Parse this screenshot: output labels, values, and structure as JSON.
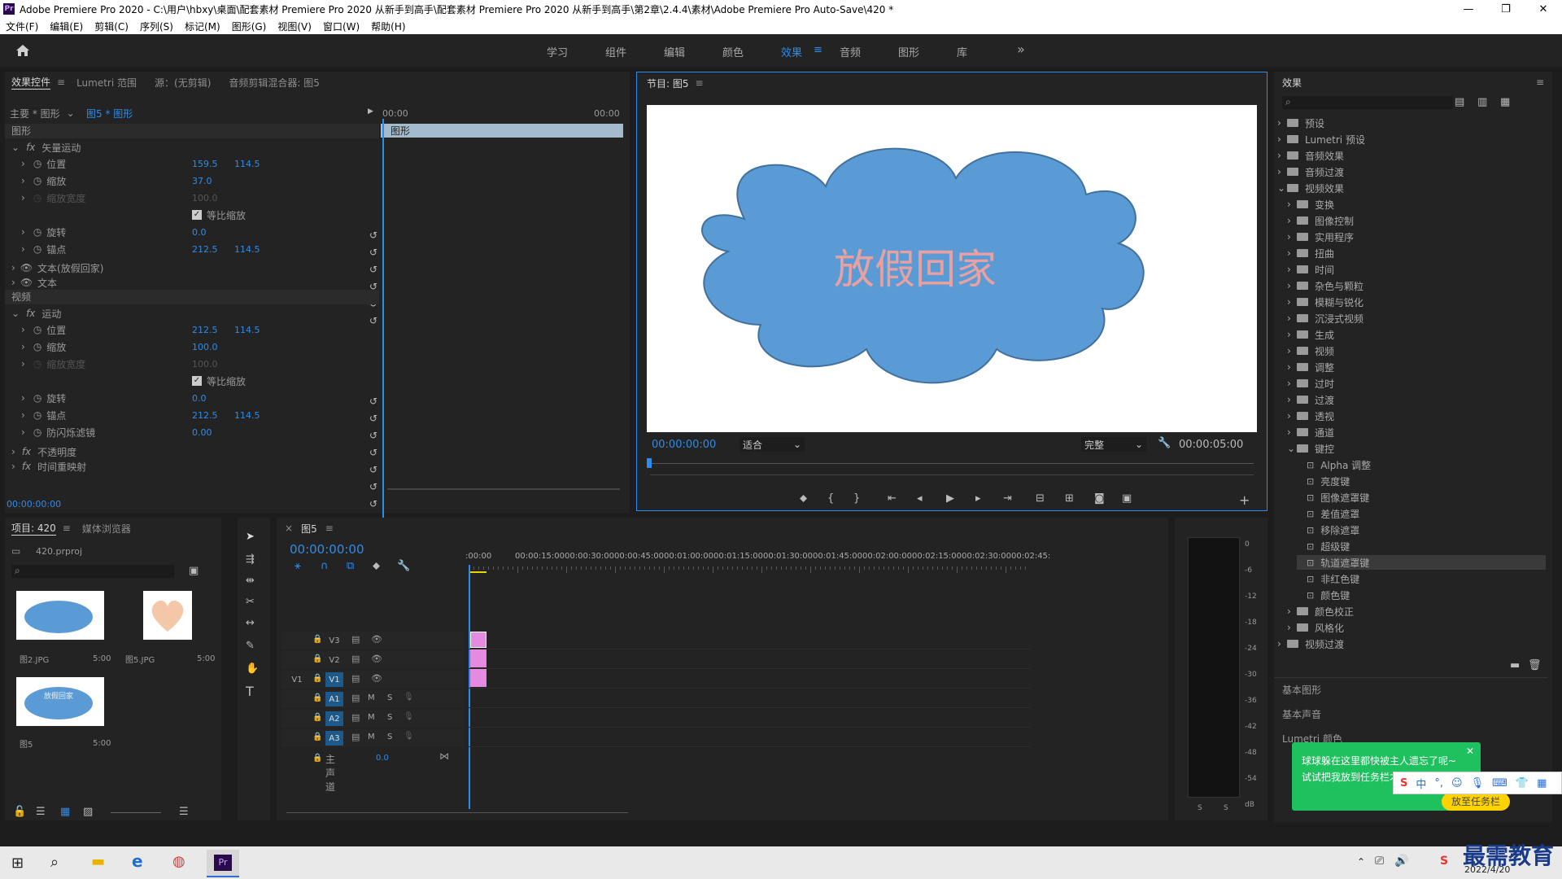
{
  "window": {
    "title": "Adobe Premiere Pro 2020 - C:\\用户\\hbxy\\桌面\\配套素材 Premiere Pro 2020 从新手到高手\\配套素材 Premiere Pro 2020 从新手到高手\\第2章\\2.4.4\\素材\\Adobe Premiere Pro Auto-Save\\420 *",
    "minimize": "—",
    "maximize": "❐",
    "close": "✕",
    "logo": "Pr"
  },
  "menu": [
    "文件(F)",
    "编辑(E)",
    "剪辑(C)",
    "序列(S)",
    "标记(M)",
    "图形(G)",
    "视图(V)",
    "窗口(W)",
    "帮助(H)"
  ],
  "workspaces": {
    "items": [
      "学习",
      "组件",
      "编辑",
      "颜色",
      "效果",
      "音频",
      "图形",
      "库"
    ],
    "active": "效果",
    "overflow": "»"
  },
  "effect_controls": {
    "tabs": [
      "效果控件",
      "Lumetri 范围",
      "源：(无剪辑)",
      "音频剪辑混合器: 图5"
    ],
    "master": "主要 * 图形",
    "clip": "图5 * 图形",
    "time_start": "00:00",
    "time_end": "00:00",
    "clip_bar": "图形",
    "section_graphic": "图形",
    "vector_motion": "矢量运动",
    "rows_graphic": [
      {
        "name": "位置",
        "v1": "159.5",
        "v2": "114.5"
      },
      {
        "name": "缩放",
        "v1": "37.0"
      },
      {
        "name": "缩放宽度",
        "v1": "100.0"
      },
      {
        "name": "等比缩放"
      },
      {
        "name": "旋转",
        "v1": "0.0"
      },
      {
        "name": "锚点",
        "v1": "212.5",
        "v2": "114.5"
      }
    ],
    "text1": "文本(放假回家)",
    "text2": "文本",
    "section_video": "视频",
    "motion": "运动",
    "rows_video": [
      {
        "name": "位置",
        "v1": "212.5",
        "v2": "114.5"
      },
      {
        "name": "缩放",
        "v1": "100.0"
      },
      {
        "name": "缩放宽度",
        "v1": "100.0"
      },
      {
        "name": "等比缩放"
      },
      {
        "name": "旋转",
        "v1": "0.0"
      },
      {
        "name": "锚点",
        "v1": "212.5",
        "v2": "114.5"
      },
      {
        "name": "防闪烁滤镜",
        "v1": "0.00"
      }
    ],
    "opacity": "不透明度",
    "time_remap": "时间重映射",
    "timecode": "00:00:00:00"
  },
  "program": {
    "tab": "节目: 图5",
    "cloud_text": "放假回家",
    "timecode": "00:00:00:00",
    "fit": "适合",
    "quality": "完整",
    "duration": "00:00:05:00"
  },
  "effects": {
    "title": "效果",
    "tree": [
      {
        "label": "预设",
        "lvl": 0,
        "open": false
      },
      {
        "label": "Lumetri 预设",
        "lvl": 0,
        "open": false
      },
      {
        "label": "音频效果",
        "lvl": 0,
        "open": false
      },
      {
        "label": "音频过渡",
        "lvl": 0,
        "open": false
      },
      {
        "label": "视频效果",
        "lvl": 0,
        "open": true
      },
      {
        "label": "变换",
        "lvl": 1,
        "open": false
      },
      {
        "label": "图像控制",
        "lvl": 1,
        "open": false
      },
      {
        "label": "实用程序",
        "lvl": 1,
        "open": false
      },
      {
        "label": "扭曲",
        "lvl": 1,
        "open": false
      },
      {
        "label": "时间",
        "lvl": 1,
        "open": false
      },
      {
        "label": "杂色与颗粒",
        "lvl": 1,
        "open": false
      },
      {
        "label": "模糊与锐化",
        "lvl": 1,
        "open": false
      },
      {
        "label": "沉浸式视频",
        "lvl": 1,
        "open": false
      },
      {
        "label": "生成",
        "lvl": 1,
        "open": false
      },
      {
        "label": "视频",
        "lvl": 1,
        "open": false
      },
      {
        "label": "调整",
        "lvl": 1,
        "open": false
      },
      {
        "label": "过时",
        "lvl": 1,
        "open": false
      },
      {
        "label": "过渡",
        "lvl": 1,
        "open": false
      },
      {
        "label": "透视",
        "lvl": 1,
        "open": false
      },
      {
        "label": "通道",
        "lvl": 1,
        "open": false
      },
      {
        "label": "键控",
        "lvl": 1,
        "open": true
      },
      {
        "label": "Alpha 调整",
        "lvl": 2
      },
      {
        "label": "亮度键",
        "lvl": 2
      },
      {
        "label": "图像遮罩键",
        "lvl": 2
      },
      {
        "label": "差值遮罩",
        "lvl": 2
      },
      {
        "label": "移除遮罩",
        "lvl": 2
      },
      {
        "label": "超级键",
        "lvl": 2
      },
      {
        "label": "轨道遮罩键",
        "lvl": 2,
        "selected": true
      },
      {
        "label": "非红色键",
        "lvl": 2
      },
      {
        "label": "颜色键",
        "lvl": 2
      },
      {
        "label": "颜色校正",
        "lvl": 1,
        "open": false
      },
      {
        "label": "风格化",
        "lvl": 1,
        "open": false
      },
      {
        "label": "视频过渡",
        "lvl": 0,
        "open": false
      }
    ],
    "sections": [
      "基本图形",
      "基本声音",
      "Lumetri 颜色"
    ]
  },
  "project": {
    "tabs": [
      "项目: 420",
      "媒体浏览器"
    ],
    "file": "420.prproj",
    "items": [
      {
        "name": "图2.JPG",
        "dur": "5:00"
      },
      {
        "name": "图5.JPG",
        "dur": "5:00"
      },
      {
        "name": "图5",
        "dur": "5:00",
        "thumb_text": "放假回家"
      }
    ]
  },
  "timeline": {
    "tab": "图5",
    "timecode": "00:00:00:00",
    "ruler": [
      ":00:00",
      "00:00:15:00",
      "00:00:30:00",
      "00:00:45:00",
      "00:01:00:00",
      "00:01:15:00",
      "00:01:30:00",
      "00:01:45:00",
      "00:02:00:00",
      "00:02:15:00",
      "00:02:30:00",
      "00:02:45:"
    ],
    "video_tracks": [
      "V3",
      "V2",
      "V1"
    ],
    "audio_tracks": [
      "A1",
      "A2",
      "A3"
    ],
    "src_v": "V1",
    "master": "主声道",
    "master_val": "0.0",
    "m": "M",
    "s": "S"
  },
  "meter": {
    "ticks": [
      "0",
      "-6",
      "-12",
      "-18",
      "-24",
      "-30",
      "-36",
      "-42",
      "-48",
      "-54",
      "dB"
    ],
    "s1": "S",
    "s2": "S"
  },
  "toast": {
    "line1": "球球躲在这里都快被主人遗忘了呢~",
    "line2": "试试把我放到任务栏才",
    "btn": "放至任务栏",
    "close": "✕"
  },
  "tray": {
    "ime": "中",
    "date": "2022/4/20"
  },
  "watermark": "最需教育"
}
